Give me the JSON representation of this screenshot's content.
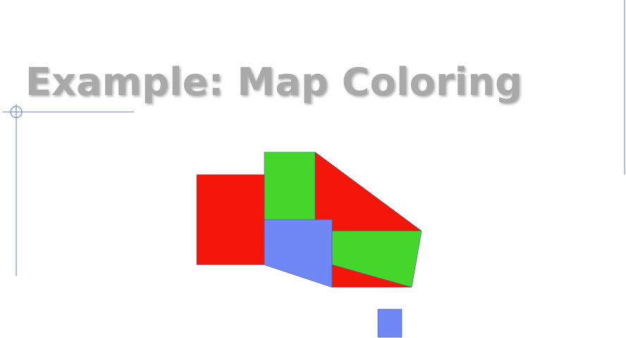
{
  "slide": {
    "title": "Example: Map Coloring"
  },
  "colors": {
    "title_text": "#a9a9a9",
    "guide_lines": "#5b7fc7",
    "region_red": "#f5160a",
    "region_green": "#45d62c",
    "region_blue": "#6f88f5"
  },
  "map": {
    "regions": [
      {
        "name": "west-region",
        "color": "red"
      },
      {
        "name": "north-region",
        "color": "green"
      },
      {
        "name": "northeast-region",
        "color": "red"
      },
      {
        "name": "central-region",
        "color": "blue"
      },
      {
        "name": "east-region",
        "color": "green"
      },
      {
        "name": "southeast-region",
        "color": "red"
      },
      {
        "name": "island-region",
        "color": "blue"
      }
    ]
  }
}
